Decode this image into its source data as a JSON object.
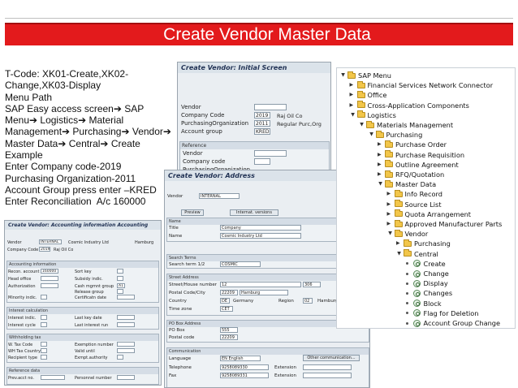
{
  "slide": {
    "title": "Create Vendor Master Data",
    "notes": [
      "T-Code: XK01-Create,XK02-",
      "Change,XK03-Display",
      "Menu Path",
      "SAP Easy access screen➔ SAP",
      "Menu➔ Logistics➔ Material",
      "Management➔ Purchasing➔ Vendor➔",
      "Master Data➔ Central➔ Create",
      "Example",
      "Enter Company code-2019",
      "Purchasing Organization-2011",
      "Account Group press enter –KRED",
      "Enter Reconciliation  A/c 160000"
    ]
  },
  "initial_screen": {
    "title": "Create Vendor:  Initial Screen",
    "vendor_label": "Vendor",
    "company_code_label": "Company Code",
    "company_code_value": "2019",
    "company_code_desc": "Raj Oil Co",
    "purch_org_label": "PurchasingOrganization",
    "purch_org_value": "2011",
    "purch_org_desc": "Regular Purc,Org",
    "account_group_label": "Account group",
    "account_group_value": "KRED",
    "reference_header": "Reference",
    "ref_vendor_label": "Vendor",
    "ref_company_label": "Company code",
    "ref_purch_label": "PurchasingOrganization"
  },
  "address_screen": {
    "title": "Create Vendor: Address",
    "vendor_label": "Vendor",
    "vendor_value": "INTERNAL",
    "preview_label": "Preview",
    "intl_versions_label": "Internat. versions",
    "name_header": "Name",
    "title_label": "Title",
    "title_value": "Company",
    "name_label": "Name",
    "name_value": "Cosmic Industry Ltd",
    "search_header": "Search Terms",
    "search_label": "Search term 1/2",
    "search_value": "COSMIC",
    "street_header": "Street Address",
    "street_label": "Street/House number",
    "street_value": "12",
    "house_value": "306",
    "postal_label": "Postal Code/City",
    "postal_value": "22209",
    "city_value": "Hamburg",
    "country_label": "Country",
    "country_value": "DE",
    "country_name": "Germany",
    "region_label": "Region",
    "region_value": "02",
    "region_name": "Hamburg",
    "timezone_label": "Time zone",
    "timezone_value": "CET",
    "pobox_header": "PO Box Address",
    "pobox_label": "PO Box",
    "pobox_value": "555",
    "pobox_postal_label": "Postal code",
    "pobox_postal_value": "22209",
    "comm_header": "Communication",
    "language_label": "Language",
    "language_value": "EN English",
    "other_comm_label": "Other communication...",
    "telephone_label": "Telephone",
    "telephone_value": "9258089330",
    "extension_label": "Extension",
    "fax_label": "Fax",
    "fax_value": "9258089331",
    "fax_ext_label": "Extension"
  },
  "accounting_screen": {
    "title": "Create Vendor: Accounting information Accounting",
    "vendor_label": "Vendor",
    "vendor_value": "INTERNAL",
    "vendor_name": "Cosmic Industry Ltd",
    "vendor_city": "Hamburg",
    "company_code_label": "Company Code",
    "company_code_value": "2019",
    "company_code_desc": "Raj Oil Co",
    "acct_mgmt_header": "Accounting information",
    "recon_label": "Recon. account",
    "recon_value": "160000",
    "sort_key_label": "Sort key",
    "head_office_label": "Head office",
    "subsidy_label": "Subsidy indic.",
    "authorization_label": "Authorization",
    "cash_mgmt_label": "Cash mgmnt group",
    "cash_mgmt_value": "A1",
    "release_label": "Release group",
    "minority_label": "Minority indic.",
    "cert_label": "Certificatn date",
    "interest_header": "Interest calculation",
    "int_indic_label": "Interest indic.",
    "last_key_label": "Last key date",
    "int_cycle_label": "Interest cycle",
    "last_run_label": "Last interest run",
    "wht_header": "Withholding tax",
    "wt_code_label": "W. Tax Code",
    "exemption_label": "Exemption number",
    "wt_country_label": "WH Tax Country",
    "valid_until_label": "Valid  until",
    "recipient_label": "Recipient type",
    "exmpt_label": "Exmpt.authority",
    "ref_header": "Reference data",
    "prev_acct_label": "Prev.acct no.",
    "personnel_label": "Personnel number"
  },
  "sap_menu": {
    "items": [
      {
        "label": "SAP Menu",
        "type": "folder",
        "level": 0,
        "expanded": true
      },
      {
        "label": "Financial Services Network Connector",
        "type": "folder",
        "level": 1,
        "expanded": false
      },
      {
        "label": "Office",
        "type": "folder",
        "level": 1,
        "expanded": false
      },
      {
        "label": "Cross-Application Components",
        "type": "folder",
        "level": 1,
        "expanded": false
      },
      {
        "label": "Logistics",
        "type": "folder",
        "level": 1,
        "expanded": true
      },
      {
        "label": "Materials Management",
        "type": "folder",
        "level": 2,
        "expanded": true
      },
      {
        "label": "Purchasing",
        "type": "folder",
        "level": 3,
        "expanded": true
      },
      {
        "label": "Purchase Order",
        "type": "folder",
        "level": 4,
        "expanded": false
      },
      {
        "label": "Purchase Requisition",
        "type": "folder",
        "level": 4,
        "expanded": false
      },
      {
        "label": "Outline Agreement",
        "type": "folder",
        "level": 4,
        "expanded": false
      },
      {
        "label": "RFQ/Quotation",
        "type": "folder",
        "level": 4,
        "expanded": false
      },
      {
        "label": "Master Data",
        "type": "folder",
        "level": 4,
        "expanded": true
      },
      {
        "label": "Info Record",
        "type": "folder",
        "level": 5,
        "expanded": false
      },
      {
        "label": "Source List",
        "type": "folder",
        "level": 5,
        "expanded": false
      },
      {
        "label": "Quota Arrangement",
        "type": "folder",
        "level": 5,
        "expanded": false
      },
      {
        "label": "Approved Manufacturer Parts",
        "type": "folder",
        "level": 5,
        "expanded": false
      },
      {
        "label": "Vendor",
        "type": "folder",
        "level": 5,
        "expanded": true
      },
      {
        "label": "Purchasing",
        "type": "folder",
        "level": 6,
        "expanded": false
      },
      {
        "label": "Central",
        "type": "folder",
        "level": 6,
        "expanded": true
      },
      {
        "label": "Create",
        "type": "tx",
        "level": 7
      },
      {
        "label": "Change",
        "type": "tx",
        "level": 7
      },
      {
        "label": "Display",
        "type": "tx",
        "level": 7
      },
      {
        "label": "Changes",
        "type": "tx",
        "level": 7
      },
      {
        "label": "Block",
        "type": "tx",
        "level": 7
      },
      {
        "label": "Flag for Deletion",
        "type": "tx",
        "level": 7
      },
      {
        "label": "Account Group Change",
        "type": "tx",
        "level": 7
      }
    ]
  },
  "colors": {
    "title_bar": "#e31a1c",
    "folder": "#f2c64a"
  }
}
